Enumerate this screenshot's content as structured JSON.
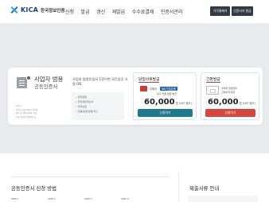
{
  "header": {
    "logo_text": "KICA",
    "logo_sub": "한국정보인증",
    "nav": [
      "신청",
      "발급",
      "갱신",
      "재발급",
      "수수료결제",
      "인증서관리"
    ],
    "buttons": [
      "가격결제카",
      "인증서카 발급"
    ]
  },
  "product": {
    "title": "사업자 범용",
    "subtitle": "공동인증서",
    "description": "사업자 범용인증서 1장이면 모든업무 사용 OK",
    "features": [
      "전자입찰",
      "전자세금계산서",
      "전자보험",
      "금융/증권/보험/카드"
    ],
    "notes": [
      "· 사업자",
      "· 사업자 공동인증서 발급용",
      "· 법인 및 개인사업자 사용",
      "· 전자거래·인터넷뱅킹 등"
    ]
  },
  "visit_card": {
    "title": "당일바로발급",
    "bank_label": "우체국",
    "bank_partner": "IBK기업은행",
    "bank_note": "창구 직접 방문 발급",
    "price": "60,000",
    "price_unit": "원 (VAT 별도)",
    "button": "신청하기",
    "button_color": "#1e7a8e"
  },
  "simple_card": {
    "title": "간편발급",
    "note_lines": [
      "우체국 방문없이",
      "간편하게 발급"
    ],
    "price": "60,000",
    "price_unit": "원 (VAT 별도)",
    "button": "신청하기",
    "button_color": "#d9453b"
  },
  "section": {
    "title": "공동인증서 신청 방법",
    "steps": [
      "STEP 1",
      "STEP 2",
      "STEP 3",
      "STEP 4"
    ],
    "side_title": "제출서류 안내"
  },
  "colors": {
    "brand": "#0f3f86",
    "hero_bg": "#e9eaed",
    "accent_red": "#d9453b",
    "accent_teal": "#1e7a8e"
  }
}
